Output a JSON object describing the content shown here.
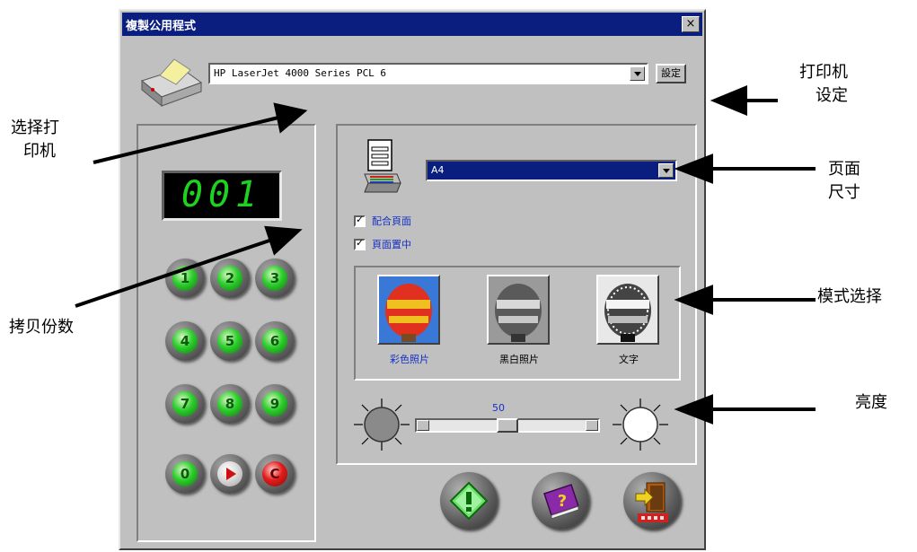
{
  "window": {
    "title": "複製公用程式",
    "close_label": "×"
  },
  "printer": {
    "selected": "HP LaserJet 4000 Series PCL 6",
    "settings_label": "設定"
  },
  "keypad": {
    "display_value": "001",
    "keys": [
      "1",
      "2",
      "3",
      "4",
      "5",
      "6",
      "7",
      "8",
      "9",
      "0",
      "",
      ""
    ],
    "clear_label": "C"
  },
  "page_size": {
    "selected": "A4"
  },
  "options": [
    {
      "label": "配合頁面",
      "checked": true
    },
    {
      "label": "頁面置中",
      "checked": true
    }
  ],
  "modes": [
    {
      "label": "彩色照片",
      "selected": true
    },
    {
      "label": "黑白照片",
      "selected": false
    },
    {
      "label": "文字",
      "selected": false
    }
  ],
  "brightness": {
    "value": "50",
    "fraction": 0.5
  },
  "buttons": {
    "start": "start-icon",
    "help": "help-icon",
    "exit": "exit-icon"
  },
  "callouts": {
    "printer_settings_line1": "打印机",
    "printer_settings_line2": "设定",
    "select_printer_line1": "选择打",
    "select_printer_line2": "印机",
    "page_size_line1": "页面",
    "page_size_line2": "尺寸",
    "copy_count": "拷贝份数",
    "mode_select": "模式选择",
    "brightness": "亮度"
  }
}
